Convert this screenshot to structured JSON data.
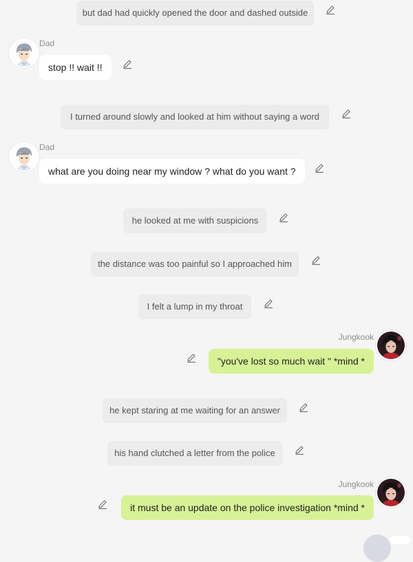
{
  "messages": [
    {
      "type": "narration",
      "text": "but dad had quickly opened the door  and dashed outside"
    },
    {
      "type": "left",
      "name": "Dad",
      "text": "stop !! wait !!"
    },
    {
      "type": "narration",
      "text": "I turned around  slowly  and looked at him  without saying  a word"
    },
    {
      "type": "left",
      "name": "Dad",
      "text": "what are you doing near my window ?  what do you want ?"
    },
    {
      "type": "narration",
      "text": "he looked at me  with suspicions"
    },
    {
      "type": "narration",
      "text": "the distance was too painful so I approached him"
    },
    {
      "type": "narration",
      "text": "I felt a lump in my throat"
    },
    {
      "type": "right",
      "name": "Jungkook",
      "text": "\"you've lost so much wait \" *mind *"
    },
    {
      "type": "narration",
      "text": "he kept staring at me waiting for an answer"
    },
    {
      "type": "narration",
      "text": "his hand clutched a letter from the police"
    },
    {
      "type": "right",
      "name": "Jungkook",
      "text": "it must be an update on the police investigation *mind *"
    }
  ],
  "icons": {
    "edit": "pencil-icon",
    "dad_avatar": "anime-man-avatar",
    "jungkook_avatar": "dark-hair-man-avatar"
  },
  "colors": {
    "background": "#f5f5f5",
    "narration_bg": "#ececec",
    "left_bubble": "#ffffff",
    "right_bubble": "#d7f296"
  }
}
